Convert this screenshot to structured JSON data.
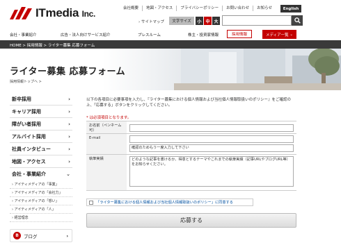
{
  "header": {
    "logo_text": "ITmedia",
    "logo_suffix": "Inc.",
    "top_links": [
      "会社概要",
      "地図・アクセス",
      "プライバシーポリシー",
      "お問い合わせ",
      "お知らせ"
    ],
    "english_label": "English",
    "sitemap_label": "サイトマップ",
    "font_size_label": "文字サイズ",
    "font_sizes": [
      "小",
      "中",
      "大"
    ],
    "search": {
      "value": "",
      "placeholder": ""
    }
  },
  "mainnav": {
    "items": [
      "会社・事業紹介",
      "広告・法人向けサービス紹介",
      "プレスルーム",
      "株主・投資家情報"
    ],
    "recruit_label": "採用情報",
    "media_label": "メディア一覧",
    "media_chevron": "⌄"
  },
  "breadcrumb": "HOME > 採用情報 > ライター募集 応募フォーム",
  "hero": {
    "title": "ライター募集 応募フォーム",
    "sub_breadcrumb": "採用情報トップへ >"
  },
  "sidebar": {
    "items": [
      {
        "label": "新卒採用",
        "chev": "›"
      },
      {
        "label": "キャリア採用",
        "chev": "›"
      },
      {
        "label": "障がい者採用",
        "chev": "›"
      },
      {
        "label": "アルバイト採用",
        "chev": "›"
      },
      {
        "label": "社員インタビュー",
        "chev": "›"
      },
      {
        "label": "地図・アクセス",
        "chev": "›"
      },
      {
        "label": "会社・事業紹介",
        "chev": "⌄"
      }
    ],
    "sub_items": [
      "› アイティメディアの「事業」",
      "› アイティメディアの「会社力」",
      "› アイティメディアの「想い」",
      "› アイティメディアの「人」",
      "› 経営理念"
    ],
    "blog_label": "ブログ",
    "blog_icon": "B",
    "blog_chev": "›"
  },
  "form": {
    "intro": "以下の各項目に必要事項を入力し、『ライター募集における個人情報および当社個人情報取扱いのポリシー』をご確認の上、「応募する」ボタンをクリックしてください。",
    "required_note": "* は必須項目となります。",
    "rows": [
      {
        "label": "お名前（ペンネーム可）",
        "placeholder": ""
      },
      {
        "label": "E-mail",
        "placeholder": "確認のためもう一度入力して下さい"
      },
      {
        "label": "執筆実績",
        "placeholder": "どのような記事を書けるか、得意とするテーマやこれまでの執筆実績（記事URLやブログURL等）をお知らせください。"
      }
    ],
    "consent_label": "「ライター募集における個人情報および当社個人情報取扱いのポリシー」に同意する",
    "submit_label": "応募する"
  },
  "colors": {
    "accent": "#c40000",
    "dark": "#3a3a3a"
  }
}
